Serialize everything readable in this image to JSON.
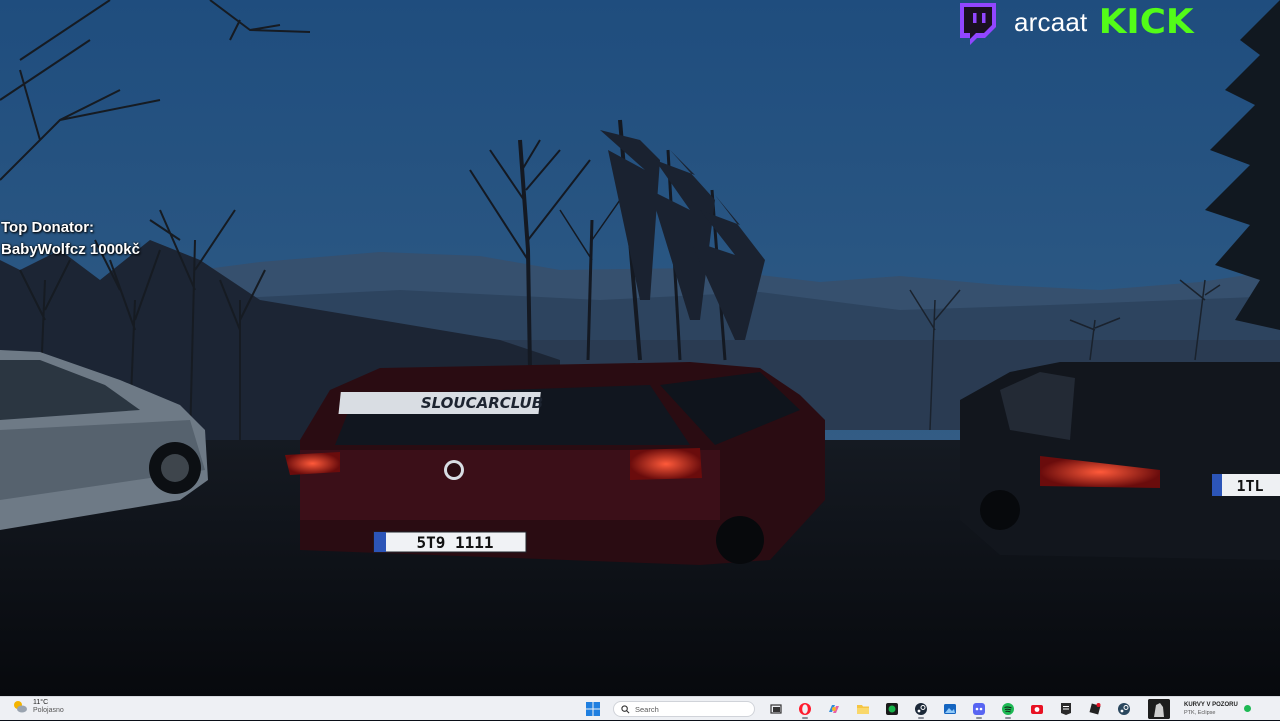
{
  "overlay": {
    "donator_heading": "Top Donator:",
    "donator_value": "BabyWolfcz 1000kč",
    "channel_name": "arcaat",
    "kick_label": "KICK"
  },
  "wallpaper": {
    "windshield_sticker": "SLOUCARCLUB",
    "plate_center": "5T9 1111",
    "plate_right": "1TL"
  },
  "taskbar": {
    "weather_temp": "11°C",
    "weather_desc": "Polojasno",
    "search_placeholder": "Search",
    "pinned_icons": [
      "windows-start-icon",
      "task-view-icon",
      "opera-icon",
      "copilot-icon",
      "file-explorer-icon",
      "xbox-icon",
      "steam-icon",
      "photos-icon",
      "discord-icon",
      "spotify-icon",
      "camera-icon",
      "epic-games-icon",
      "roblox-icon",
      "steam-alt-icon"
    ],
    "media_title": "KURVY V POZORU",
    "media_artist": "PTK, Eclipse"
  },
  "colors": {
    "kick_green": "#53fc18",
    "twitch_purple": "#9146ff",
    "taskbar_bg": "#eef0f4"
  }
}
